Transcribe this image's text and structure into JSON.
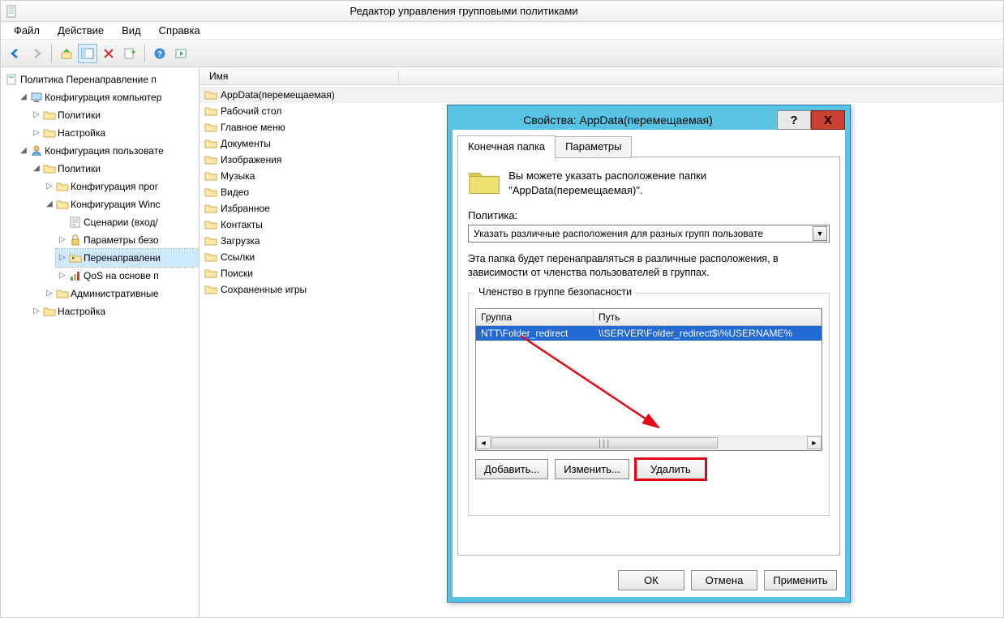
{
  "window": {
    "title": "Редактор управления групповыми политиками"
  },
  "menu": {
    "file": "Файл",
    "action": "Действие",
    "view": "Вид",
    "help": "Справка"
  },
  "tree": {
    "root": "Политика Перенаправление п",
    "computer_cfg": "Конфигурация компьютер",
    "c_policies": "Политики",
    "c_settings": "Настройка",
    "user_cfg": "Конфигурация пользовате",
    "u_policies": "Политики",
    "soft_cfg": "Конфигурация прог",
    "win_cfg": "Конфигурация Winс",
    "scenarios": "Сценарии (вход/",
    "security": "Параметры безо",
    "redirect": "Перенаправлени",
    "qos": "QoS на основе п",
    "admin_tmpl": "Административные",
    "u_settings": "Настройка"
  },
  "list": {
    "header_name": "Имя",
    "items": [
      "AppData(перемещаемая)",
      "Рабочий стол",
      "Главное меню",
      "Документы",
      "Изображения",
      "Музыка",
      "Видео",
      "Избранное",
      "Контакты",
      "Загрузка",
      "Ссылки",
      "Поиски",
      "Сохраненные игры"
    ]
  },
  "dialog": {
    "title": "Свойства: AppData(перемещаемая)",
    "tab_target": "Конечная папка",
    "tab_params": "Параметры",
    "info_text": "Вы можете указать расположение папки \"AppData(перемещаемая)\".",
    "policy_label": "Политика:",
    "combo_value": "Указать различные расположения для разных групп пользовате",
    "desc_text": "Эта папка будет перенаправляться в различные расположения, в зависимости от членства пользователей в группах.",
    "groupbox_legend": "Членство в группе безопасности",
    "grid": {
      "col_group": "Группа",
      "col_path": "Путь",
      "row_group": "NTT\\Folder_redirect",
      "row_path": "\\\\SERVER\\Folder_redirect$\\%USERNAME%"
    },
    "btn_add": "Добавить...",
    "btn_edit": "Изменить...",
    "btn_delete": "Удалить",
    "btn_ok": "ОК",
    "btn_cancel": "Отмена",
    "btn_apply": "Применить",
    "help": "?",
    "close": "X"
  }
}
